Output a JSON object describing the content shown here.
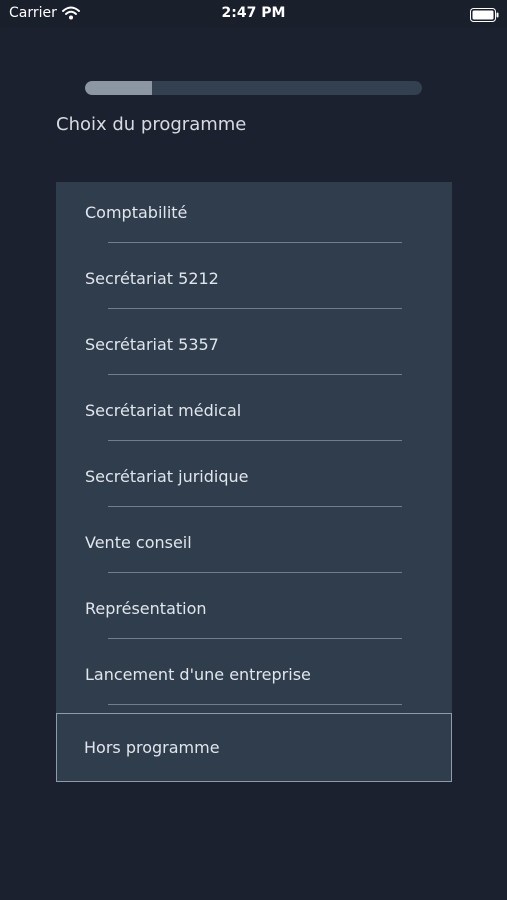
{
  "status_bar": {
    "carrier": "Carrier",
    "time": "2:47 PM",
    "icons": [
      "wifi-icon",
      "battery-icon"
    ]
  },
  "progress": {
    "fraction": 0.2
  },
  "page": {
    "title": "Choix du programme"
  },
  "programs": [
    {
      "label": "Comptabilité"
    },
    {
      "label": "Secrétariat 5212"
    },
    {
      "label": "Secrétariat 5357"
    },
    {
      "label": "Secrétariat médical"
    },
    {
      "label": "Secrétariat juridique"
    },
    {
      "label": "Vente conseil"
    },
    {
      "label": "Représentation"
    },
    {
      "label": "Lancement d'une entreprise"
    }
  ],
  "hors_programme": {
    "label": "Hors programme"
  },
  "colors": {
    "background": "#1c2130",
    "panel": "#2f3d4d",
    "progress_track": "#324050",
    "progress_fill": "#8d97a3",
    "divider": "#6f7f90",
    "selected_border": "#8e9bab"
  }
}
